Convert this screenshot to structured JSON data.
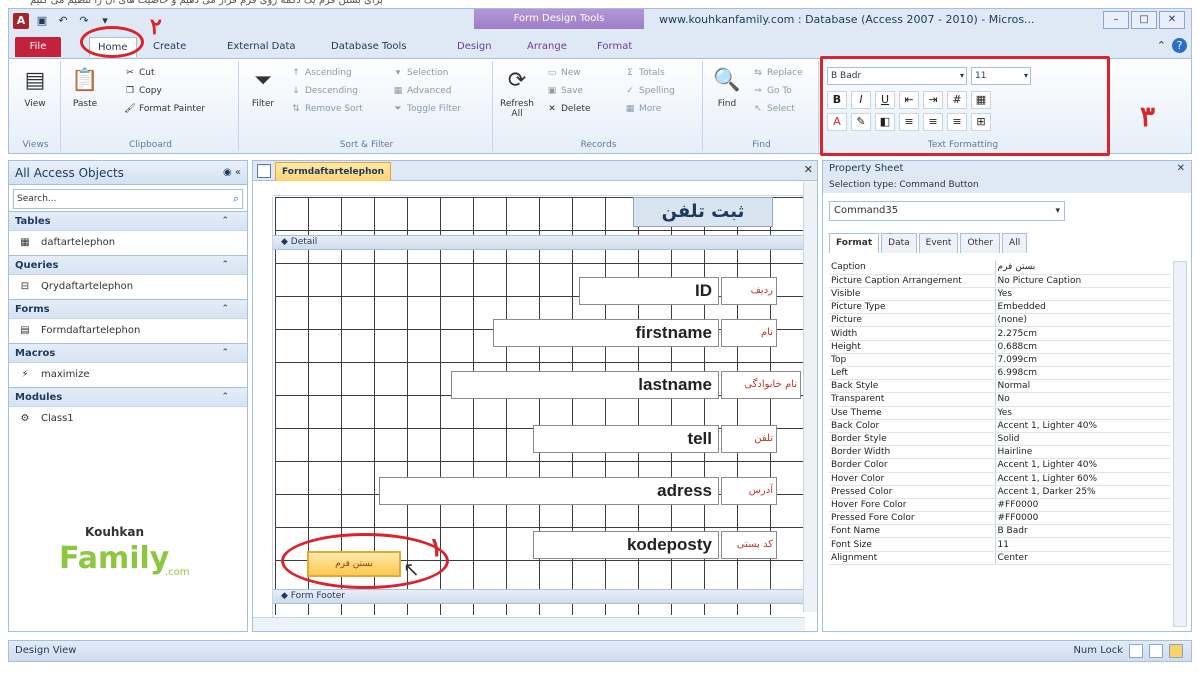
{
  "window": {
    "title": "www.kouhkanfamily.com : Database (Access 2007 - 2010)  -  Micros...",
    "context_group": "Form Design Tools"
  },
  "tabs": [
    "File",
    "Home",
    "Create",
    "External Data",
    "Database Tools",
    "Design",
    "Arrange",
    "Format"
  ],
  "ribbon": {
    "views": {
      "view": "View",
      "label": "Views"
    },
    "clipboard": {
      "paste": "Paste",
      "cut": "Cut",
      "copy": "Copy",
      "format_painter": "Format Painter",
      "label": "Clipboard"
    },
    "sort": {
      "filter": "Filter",
      "ascending": "Ascending",
      "descending": "Descending",
      "remove_sort": "Remove Sort",
      "selection": "Selection",
      "advanced": "Advanced",
      "toggle_filter": "Toggle Filter",
      "label": "Sort & Filter"
    },
    "records": {
      "refresh": "Refresh All",
      "new": "New",
      "save": "Save",
      "delete": "Delete",
      "totals": "Totals",
      "spelling": "Spelling",
      "more": "More",
      "label": "Records"
    },
    "find": {
      "find": "Find",
      "replace": "Replace",
      "goto": "Go To",
      "select": "Select",
      "label": "Find"
    },
    "text_formatting": {
      "font": "B Badr",
      "size": "11",
      "label": "Text Formatting"
    }
  },
  "annotations": {
    "one": "١",
    "two": "٢",
    "three": "٣"
  },
  "nav": {
    "title": "All Access Objects",
    "search_placeholder": "Search...",
    "sections": [
      {
        "name": "Tables",
        "items": [
          "daftartelephon"
        ]
      },
      {
        "name": "Queries",
        "items": [
          "Qrydaftartelephon"
        ]
      },
      {
        "name": "Forms",
        "items": [
          "Formdaftartelephon"
        ]
      },
      {
        "name": "Macros",
        "items": [
          "maximize"
        ]
      },
      {
        "name": "Modules",
        "items": [
          "Class1"
        ]
      }
    ],
    "logo": {
      "line1": "Kouhkan",
      "line2": "Family",
      "line3": ".com"
    }
  },
  "document": {
    "tab": "Formdaftartelephon",
    "header_label": "ثبت تلفن",
    "detail_label": "Detail",
    "footer_label": "Form Footer",
    "fields": [
      {
        "value": "ID",
        "label": "ردیف"
      },
      {
        "value": "firstname",
        "label": "نام"
      },
      {
        "value": "lastname",
        "label": "نام خانوادگی"
      },
      {
        "value": "tell",
        "label": "تلفن"
      },
      {
        "value": "adress",
        "label": "آدرس"
      },
      {
        "value": "kodeposty",
        "label": "کد پستی"
      }
    ],
    "command_button": "بستن فرم"
  },
  "property_sheet": {
    "title": "Property Sheet",
    "selection_type": "Selection type:  Command Button",
    "selected": "Command35",
    "tabs": [
      "Format",
      "Data",
      "Event",
      "Other",
      "All"
    ],
    "rows": [
      [
        "Caption",
        "بستن فرم"
      ],
      [
        "Picture Caption Arrangement",
        "No Picture Caption"
      ],
      [
        "Visible",
        "Yes"
      ],
      [
        "Picture Type",
        "Embedded"
      ],
      [
        "Picture",
        "(none)"
      ],
      [
        "Width",
        "2.275cm"
      ],
      [
        "Height",
        "0.688cm"
      ],
      [
        "Top",
        "7.099cm"
      ],
      [
        "Left",
        "6.998cm"
      ],
      [
        "Back Style",
        "Normal"
      ],
      [
        "Transparent",
        "No"
      ],
      [
        "Use Theme",
        "Yes"
      ],
      [
        "Back Color",
        "Accent 1, Lighter 40%"
      ],
      [
        "Border Style",
        "Solid"
      ],
      [
        "Border Width",
        "Hairline"
      ],
      [
        "Border Color",
        "Accent 1, Lighter 40%"
      ],
      [
        "Hover Color",
        "Accent 1, Lighter 60%"
      ],
      [
        "Pressed Color",
        "Accent 1, Darker 25%"
      ],
      [
        "Hover Fore Color",
        "#FF0000"
      ],
      [
        "Pressed Fore Color",
        "#FF0000"
      ],
      [
        "Font Name",
        "B Badr"
      ],
      [
        "Font Size",
        "11"
      ],
      [
        "Alignment",
        "Center"
      ]
    ]
  },
  "status": {
    "left": "Design View",
    "right": "Num Lock"
  }
}
